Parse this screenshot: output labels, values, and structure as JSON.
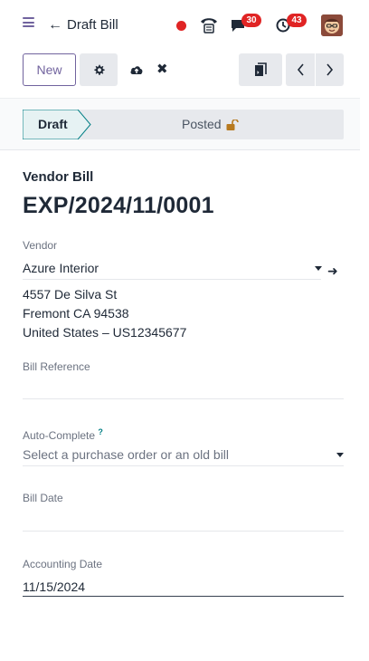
{
  "header": {
    "title": "Draft Bill",
    "messages_count": "30",
    "activities_count": "43"
  },
  "control_panel": {
    "new_label": "New"
  },
  "statusbar": {
    "draft_label": "Draft",
    "posted_label": "Posted"
  },
  "form": {
    "document_type": "Vendor Bill",
    "document_name": "EXP/2024/11/0001",
    "vendor": {
      "label": "Vendor",
      "value": "Azure Interior",
      "address_line1": "4557 De Silva St",
      "address_line2": "Fremont CA 94538",
      "address_line3": "United States – US12345677"
    },
    "bill_reference": {
      "label": "Bill Reference",
      "value": ""
    },
    "auto_complete": {
      "label": "Auto-Complete",
      "help_marker": "?",
      "placeholder": "Select a purchase order or an old bill"
    },
    "bill_date": {
      "label": "Bill Date",
      "value": ""
    },
    "accounting_date": {
      "label": "Accounting Date",
      "value": "11/15/2024"
    }
  },
  "colors": {
    "brand": "#71639e",
    "badge": "#e02424",
    "help": "#017e84",
    "lock": "#b7791f"
  },
  "icons": [
    "menu-icon",
    "back-arrow-icon",
    "recording-dot-icon",
    "phone-icon",
    "chat-icon",
    "clock-icon",
    "gear-icon",
    "cloud-upload-icon",
    "discard-icon",
    "attachment-icon",
    "chevron-left-icon",
    "chevron-right-icon",
    "lock-icon",
    "caret-down-icon",
    "external-link-arrow-icon"
  ]
}
